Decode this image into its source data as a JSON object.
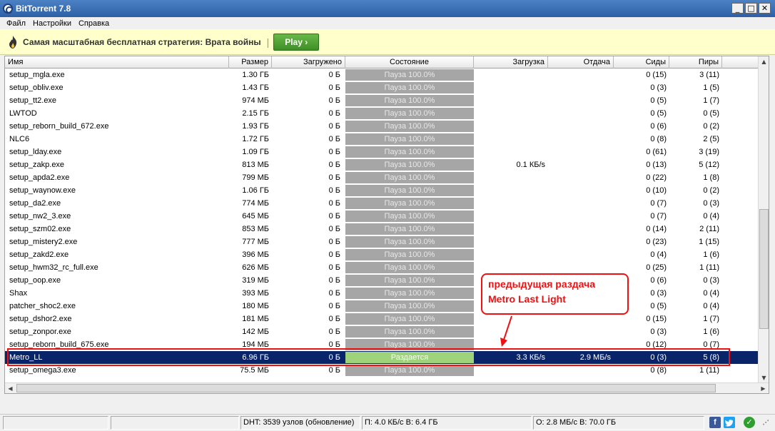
{
  "window": {
    "title": "BitTorrent 7.8",
    "buttons": [
      "_",
      "□",
      "✕"
    ]
  },
  "menu": [
    "Файл",
    "Настройки",
    "Справка"
  ],
  "ad": {
    "text": "Самая масштабная бесплатная стратегия: Врата войны",
    "separator": "|",
    "play_label": "Play ›"
  },
  "table": {
    "columns": [
      "Имя",
      "Размер",
      "Загружено",
      "Состояние",
      "Загрузка",
      "Отдача",
      "Сиды",
      "Пиры"
    ],
    "rows": [
      {
        "name": "setup_mgla.exe",
        "size": "1.30 ГБ",
        "downloaded": "0 Б",
        "state": "Пауза 100.0%",
        "dl": "",
        "ul": "",
        "seeds": "0 (15)",
        "peers": "3 (11)"
      },
      {
        "name": "setup_obliv.exe",
        "size": "1.43 ГБ",
        "downloaded": "0 Б",
        "state": "Пауза 100.0%",
        "dl": "",
        "ul": "",
        "seeds": "0 (3)",
        "peers": "1 (5)"
      },
      {
        "name": "setup_tt2.exe",
        "size": "974 МБ",
        "downloaded": "0 Б",
        "state": "Пауза 100.0%",
        "dl": "",
        "ul": "",
        "seeds": "0 (5)",
        "peers": "1 (7)"
      },
      {
        "name": "LWTOD",
        "size": "2.15 ГБ",
        "downloaded": "0 Б",
        "state": "Пауза 100.0%",
        "dl": "",
        "ul": "",
        "seeds": "0 (5)",
        "peers": "0 (5)"
      },
      {
        "name": "setup_reborn_build_672.exe",
        "size": "1.93 ГБ",
        "downloaded": "0 Б",
        "state": "Пауза 100.0%",
        "dl": "",
        "ul": "",
        "seeds": "0 (6)",
        "peers": "0 (2)"
      },
      {
        "name": "NLC6",
        "size": "1.72 ГБ",
        "downloaded": "0 Б",
        "state": "Пауза 100.0%",
        "dl": "",
        "ul": "",
        "seeds": "0 (8)",
        "peers": "2 (5)"
      },
      {
        "name": "setup_lday.exe",
        "size": "1.09 ГБ",
        "downloaded": "0 Б",
        "state": "Пауза 100.0%",
        "dl": "",
        "ul": "",
        "seeds": "0 (61)",
        "peers": "3 (19)"
      },
      {
        "name": "setup_zakp.exe",
        "size": "813 МБ",
        "downloaded": "0 Б",
        "state": "Пауза 100.0%",
        "dl": "0.1 КБ/s",
        "ul": "",
        "seeds": "0 (13)",
        "peers": "5 (12)"
      },
      {
        "name": "setup_apda2.exe",
        "size": "799 МБ",
        "downloaded": "0 Б",
        "state": "Пауза 100.0%",
        "dl": "",
        "ul": "",
        "seeds": "0 (22)",
        "peers": "1 (8)"
      },
      {
        "name": "setup_waynow.exe",
        "size": "1.06 ГБ",
        "downloaded": "0 Б",
        "state": "Пауза 100.0%",
        "dl": "",
        "ul": "",
        "seeds": "0 (10)",
        "peers": "0 (2)"
      },
      {
        "name": "setup_da2.exe",
        "size": "774 МБ",
        "downloaded": "0 Б",
        "state": "Пауза 100.0%",
        "dl": "",
        "ul": "",
        "seeds": "0 (7)",
        "peers": "0 (3)"
      },
      {
        "name": "setup_nw2_3.exe",
        "size": "645 МБ",
        "downloaded": "0 Б",
        "state": "Пауза 100.0%",
        "dl": "",
        "ul": "",
        "seeds": "0 (7)",
        "peers": "0 (4)"
      },
      {
        "name": "setup_szm02.exe",
        "size": "853 МБ",
        "downloaded": "0 Б",
        "state": "Пауза 100.0%",
        "dl": "",
        "ul": "",
        "seeds": "0 (14)",
        "peers": "2 (11)"
      },
      {
        "name": "setup_mistery2.exe",
        "size": "777 МБ",
        "downloaded": "0 Б",
        "state": "Пауза 100.0%",
        "dl": "",
        "ul": "",
        "seeds": "0 (23)",
        "peers": "1 (15)"
      },
      {
        "name": "setup_zakd2.exe",
        "size": "396 МБ",
        "downloaded": "0 Б",
        "state": "Пауза 100.0%",
        "dl": "",
        "ul": "",
        "seeds": "0 (4)",
        "peers": "1 (6)"
      },
      {
        "name": "setup_hwm32_rc_full.exe",
        "size": "626 МБ",
        "downloaded": "0 Б",
        "state": "Пауза 100.0%",
        "dl": "",
        "ul": "",
        "seeds": "0 (25)",
        "peers": "1 (11)"
      },
      {
        "name": "setup_oop.exe",
        "size": "319 МБ",
        "downloaded": "0 Б",
        "state": "Пауза 100.0%",
        "dl": "",
        "ul": "",
        "seeds": "0 (6)",
        "peers": "0 (3)"
      },
      {
        "name": "Shax",
        "size": "393 МБ",
        "downloaded": "0 Б",
        "state": "Пауза 100.0%",
        "dl": "",
        "ul": "",
        "seeds": "0 (3)",
        "peers": "0 (4)"
      },
      {
        "name": "patcher_shoc2.exe",
        "size": "180 МБ",
        "downloaded": "0 Б",
        "state": "Пауза 100.0%",
        "dl": "",
        "ul": "",
        "seeds": "0 (5)",
        "peers": "0 (4)"
      },
      {
        "name": "setup_dshor2.exe",
        "size": "181 МБ",
        "downloaded": "0 Б",
        "state": "Пауза 100.0%",
        "dl": "",
        "ul": "",
        "seeds": "0 (15)",
        "peers": "1 (7)"
      },
      {
        "name": "setup_zonpor.exe",
        "size": "142 МБ",
        "downloaded": "0 Б",
        "state": "Пауза 100.0%",
        "dl": "",
        "ul": "",
        "seeds": "0 (3)",
        "peers": "1 (6)"
      },
      {
        "name": "setup_reborn_build_675.exe",
        "size": "194 МБ",
        "downloaded": "0 Б",
        "state": "Пауза 100.0%",
        "dl": "",
        "ul": "",
        "seeds": "0 (12)",
        "peers": "0 (7)"
      },
      {
        "name": "Metro_LL",
        "size": "6.96 ГБ",
        "downloaded": "0 Б",
        "state": "Раздается",
        "dl": "3.3 КБ/s",
        "ul": "2.9 МБ/s",
        "seeds": "0 (3)",
        "peers": "5 (8)",
        "selected": true
      },
      {
        "name": "setup_omega3.exe",
        "size": "75.5 МБ",
        "downloaded": "0 Б",
        "state": "Пауза 100.0%",
        "dl": "",
        "ul": "",
        "seeds": "0 (8)",
        "peers": "1 (11)"
      }
    ]
  },
  "annotation": {
    "line1": "предыдущая раздача",
    "line2": "Metro Last Light",
    "color": "#ee1111"
  },
  "statusbar": {
    "dht": "DHT: 3539 узлов  (обновление)",
    "down": "П: 4.0 КБ/с В: 6.4 ГБ",
    "up": "О: 2.8 МБ/с В: 70.0 ГБ"
  },
  "colors": {
    "paused_bar": "#a6a6a6",
    "seeding_bar": "#9ed37c",
    "selected_row": "#0a246a"
  }
}
